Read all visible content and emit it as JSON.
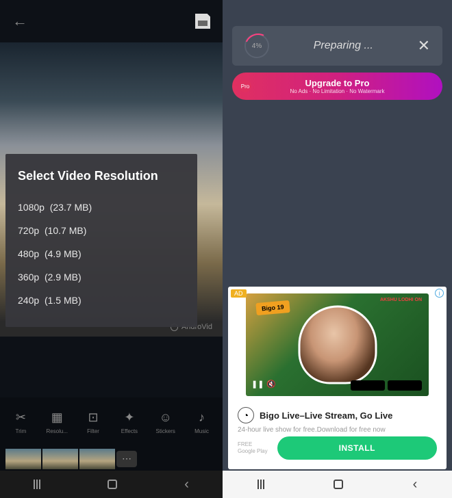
{
  "left": {
    "resolution_dialog": {
      "title": "Select Video Resolution",
      "options": [
        {
          "label": "1080p",
          "size": "(23.7 MB)"
        },
        {
          "label": "720p",
          "size": "(10.7 MB)"
        },
        {
          "label": "480p",
          "size": "(4.9 MB)"
        },
        {
          "label": "360p",
          "size": "(2.9 MB)"
        },
        {
          "label": "240p",
          "size": "(1.5 MB)"
        }
      ]
    },
    "watermark": "AndroVid",
    "toolbar": [
      {
        "icon": "✂",
        "label": "Trim"
      },
      {
        "icon": "▦",
        "label": "Resolu..."
      },
      {
        "icon": "⊡",
        "label": "Filter"
      },
      {
        "icon": "✦",
        "label": "Effects"
      },
      {
        "icon": "☺",
        "label": "Stickers"
      },
      {
        "icon": "♪",
        "label": "Music"
      }
    ]
  },
  "right": {
    "preparing": {
      "percent": "4%",
      "text": "Preparing ..."
    },
    "upgrade": {
      "title": "Upgrade to Pro",
      "subtitle": "No Ads · No Limitation · No Watermark"
    },
    "ad": {
      "badge": "AD",
      "bigo_badge": "Bigo 19",
      "small_text": "AKSHU LODHI ON",
      "app_name": "Bigo Live–Live Stream, Go Live",
      "description": "24-hour live show for free.Download for free now",
      "meta_line1": "FREE",
      "meta_line2": "Google Play",
      "install": "INSTALL"
    }
  }
}
